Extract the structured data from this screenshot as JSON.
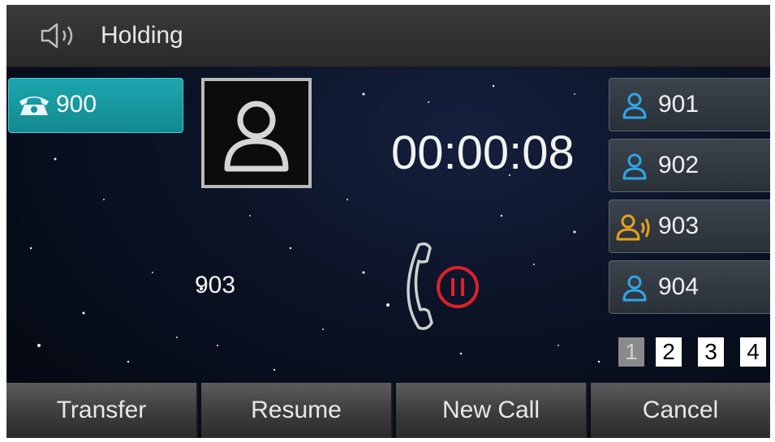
{
  "title_bar": {
    "icon": "speaker-icon",
    "text": "Holding"
  },
  "line_key": {
    "icon": "phone-icon",
    "label": "900",
    "color": "#1aa2aa"
  },
  "call": {
    "avatar_icon": "contact-avatar-icon",
    "timer": "00:00:08",
    "caller": "903",
    "status_icon": "call-hold-icon",
    "hold_color": "#e0202a"
  },
  "account_keys": [
    {
      "label": "901",
      "icon": "user-icon",
      "state": "idle",
      "icon_color": "#2fa6e8"
    },
    {
      "label": "902",
      "icon": "user-icon",
      "state": "idle",
      "icon_color": "#2fa6e8"
    },
    {
      "label": "903",
      "icon": "user-talking-icon",
      "state": "active",
      "icon_color": "#e6a21a"
    },
    {
      "label": "904",
      "icon": "user-icon",
      "state": "idle",
      "icon_color": "#2fa6e8"
    }
  ],
  "pages": [
    {
      "label": "1",
      "active": true
    },
    {
      "label": "2",
      "active": false
    },
    {
      "label": "3",
      "active": false
    },
    {
      "label": "4",
      "active": false
    }
  ],
  "softkeys": [
    "Transfer",
    "Resume",
    "New Call",
    "Cancel"
  ]
}
